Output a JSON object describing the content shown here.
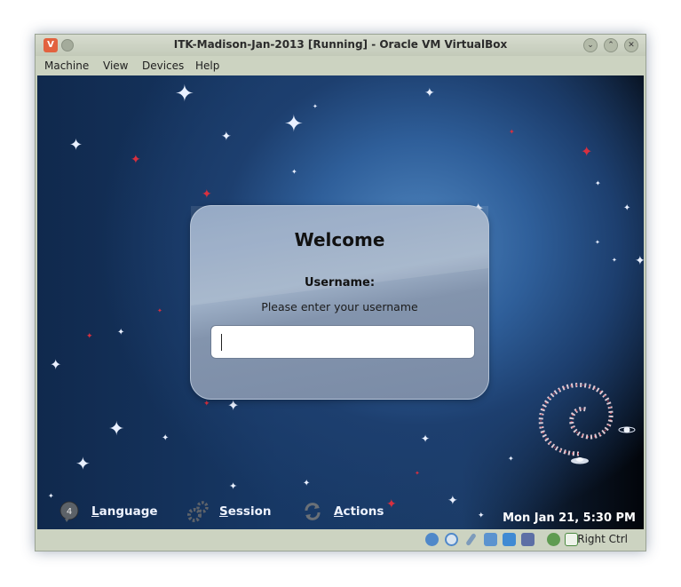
{
  "window": {
    "title": "ITK-Madison-Jan-2013 [Running] - Oracle VM VirtualBox",
    "app_icon": "virtualbox-icon",
    "buttons": {
      "minimize": "⌄",
      "maximize": "⌃",
      "close": "✕"
    }
  },
  "menubar": {
    "items": [
      "Machine",
      "View",
      "Devices",
      "Help"
    ]
  },
  "login": {
    "title": "Welcome",
    "username_label": "Username:",
    "hint": "Please enter your username",
    "input_value": ""
  },
  "bottom_bar": {
    "language": {
      "first": "L",
      "rest": "anguage"
    },
    "session": {
      "first": "S",
      "rest": "ession"
    },
    "actions": {
      "first": "A",
      "rest": "ctions"
    },
    "clock": "Mon Jan 21,  5:30 PM"
  },
  "statusbar": {
    "icons": [
      "hard-disk-icon",
      "optical-disk-icon",
      "usb-icon",
      "network-icon",
      "shared-folder-icon",
      "display-icon",
      "capture-icon",
      "keyboard-icon"
    ],
    "host_key": "Right Ctrl"
  },
  "colors": {
    "desktop_blue": "#2f5f9a",
    "dialog": "#8aa0bf",
    "star_red": "#d8303f"
  }
}
